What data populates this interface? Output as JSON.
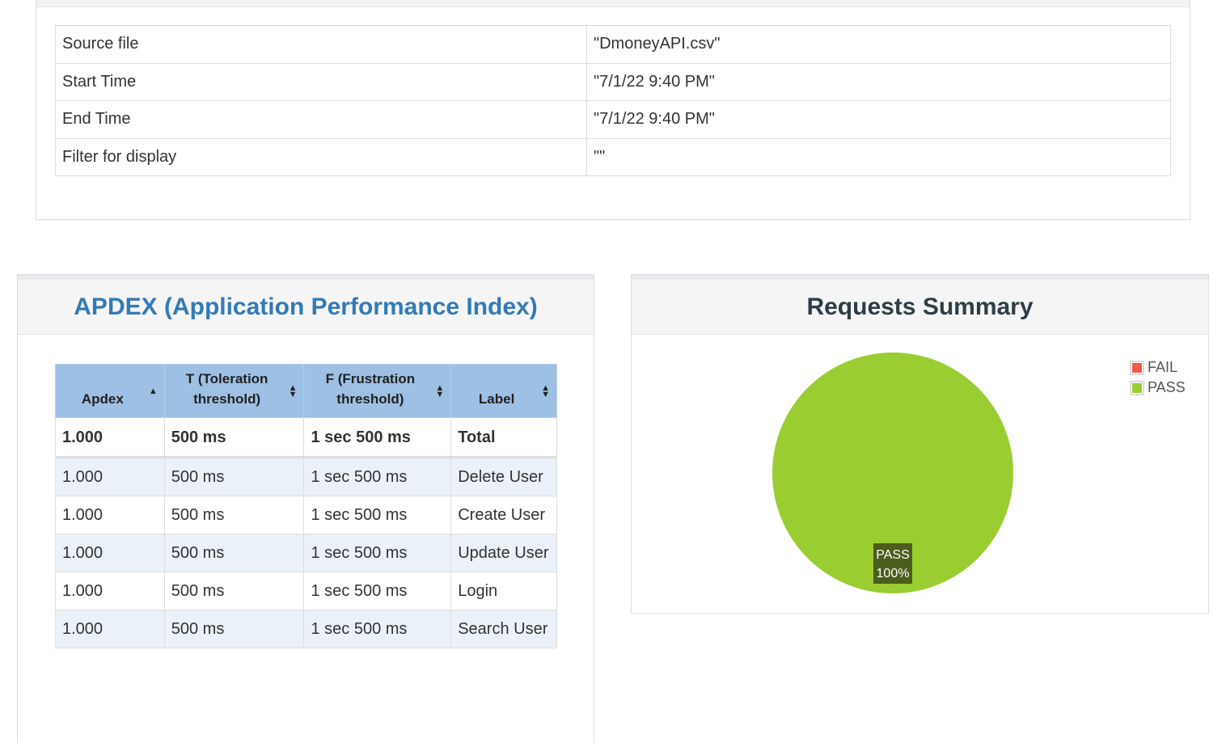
{
  "stats_info": {
    "rows": [
      {
        "key": "Source file",
        "value": "\"DmoneyAPI.csv\""
      },
      {
        "key": "Start Time",
        "value": "\"7/1/22 9:40 PM\""
      },
      {
        "key": "End Time",
        "value": "\"7/1/22 9:40 PM\""
      },
      {
        "key": "Filter for display",
        "value": "\"\""
      }
    ]
  },
  "apdex": {
    "title": "APDEX (Application Performance Index)",
    "headers": {
      "apdex": "Apdex",
      "t": "T (Toleration threshold)",
      "f": "F (Frustration threshold)",
      "label": "Label"
    },
    "rows": [
      {
        "apdex": "1.000",
        "t": "500 ms",
        "f": "1 sec 500 ms",
        "label": "Total"
      },
      {
        "apdex": "1.000",
        "t": "500 ms",
        "f": "1 sec 500 ms",
        "label": "Delete User"
      },
      {
        "apdex": "1.000",
        "t": "500 ms",
        "f": "1 sec 500 ms",
        "label": "Create User"
      },
      {
        "apdex": "1.000",
        "t": "500 ms",
        "f": "1 sec 500 ms",
        "label": "Update User"
      },
      {
        "apdex": "1.000",
        "t": "500 ms",
        "f": "1 sec 500 ms",
        "label": "Login"
      },
      {
        "apdex": "1.000",
        "t": "500 ms",
        "f": "1 sec 500 ms",
        "label": "Search User"
      }
    ]
  },
  "requests_summary": {
    "title": "Requests Summary"
  },
  "chart_data": {
    "type": "pie",
    "title": "Requests Summary",
    "legend_position": "top-right",
    "slices": [
      {
        "name": "FAIL",
        "value": 0,
        "color": "#f25c4a"
      },
      {
        "name": "PASS",
        "value": 100,
        "color": "#9acd32"
      }
    ],
    "data_labels": [
      {
        "name": "PASS",
        "percent": "100%"
      }
    ]
  }
}
